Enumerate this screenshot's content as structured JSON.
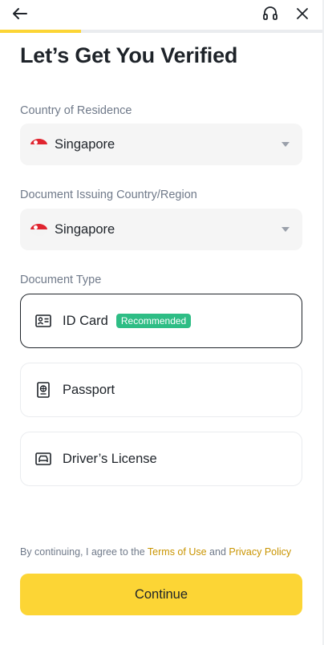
{
  "header": {
    "back_icon": "arrow-left-icon",
    "support_icon": "headset-icon",
    "close_icon": "close-icon",
    "progress": 0.25,
    "progress_color": "#fcd535"
  },
  "title": "Let’s Get You Verified",
  "residence": {
    "label": "Country of Residence",
    "value": "Singapore",
    "flag_icon": "singapore-flag-icon"
  },
  "issuing": {
    "label": "Document Issuing Country/Region",
    "value": "Singapore",
    "flag_icon": "singapore-flag-icon"
  },
  "document_type": {
    "label": "Document Type",
    "options": [
      {
        "label": "ID Card",
        "badge": "Recommended",
        "icon": "id-card-icon",
        "selected": true
      },
      {
        "label": "Passport",
        "icon": "passport-icon",
        "selected": false
      },
      {
        "label": "Driver’s License",
        "icon": "drivers-license-icon",
        "selected": false
      }
    ]
  },
  "terms": {
    "prefix": "By continuing, I agree to the",
    "terms_link": "Terms of Use",
    "joiner": "and",
    "privacy_link": "Privacy Policy"
  },
  "continue_label": "Continue",
  "colors": {
    "accent": "#fcd535",
    "link": "#c99400",
    "badge": "#2ebd85",
    "text": "#1e2329",
    "muted": "#707a8a"
  }
}
